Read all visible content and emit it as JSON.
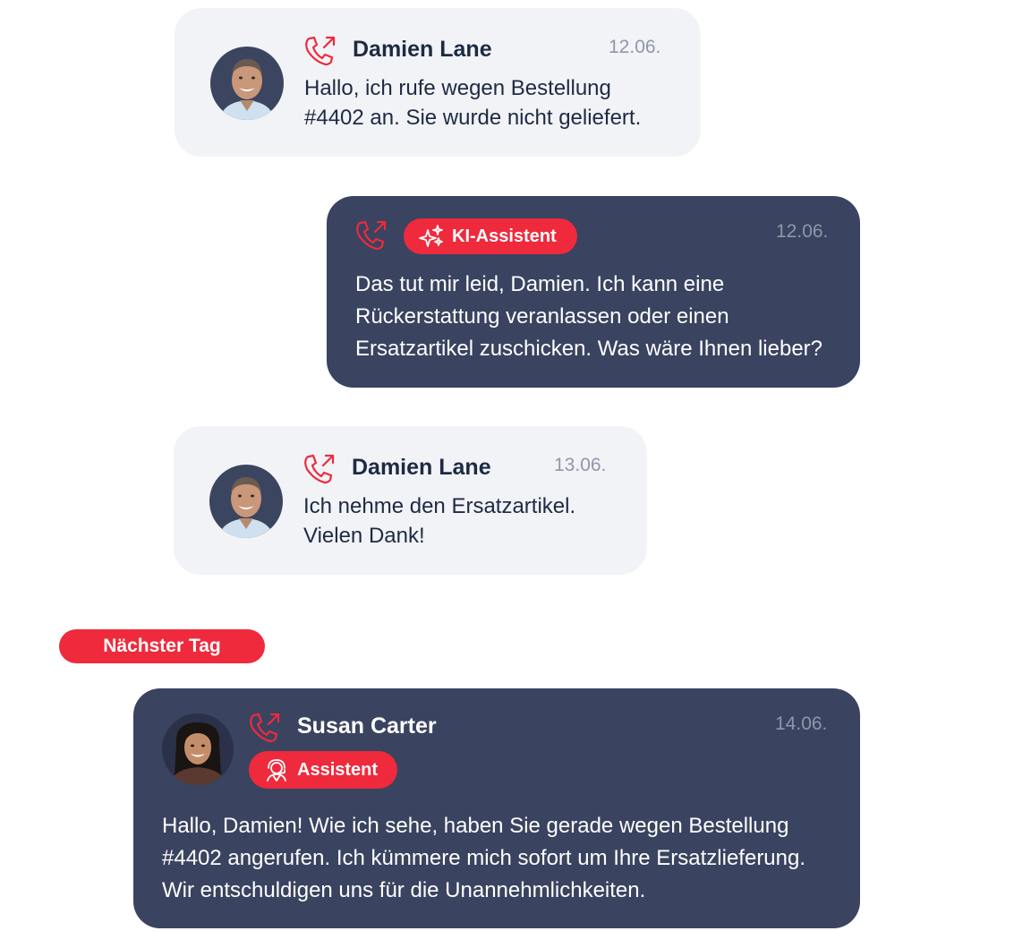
{
  "colors": {
    "accent": "#ee2a3c",
    "dark_bubble": "#3a4360",
    "light_bubble": "#f1f3f6",
    "date_text": "#8f97a9"
  },
  "messages": [
    {
      "sender": "Damien Lane",
      "date": "12.06.",
      "text": "Hallo, ich rufe wegen Bestellung #4402 an. Sie wurde nicht geliefert.",
      "icon": "phone-outgoing-icon"
    },
    {
      "badge": "KI-Assistent",
      "badge_icon": "sparkles-icon",
      "date": "12.06.",
      "text": "Das tut mir leid, Damien. Ich kann eine Rückerstattung veranlassen oder einen Ersatzartikel zuschicken. Was wäre Ihnen lieber?",
      "icon": "phone-outgoing-icon"
    },
    {
      "sender": "Damien Lane",
      "date": "13.06.",
      "text": "Ich nehme den Ersatzartikel. Vielen Dank!",
      "icon": "phone-outgoing-icon"
    },
    {
      "sender": "Susan Carter",
      "badge": "Assistent",
      "badge_icon": "agent-icon",
      "date": "14.06.",
      "text": "Hallo, Damien! Wie ich sehe, haben Sie gerade wegen Bestellung #4402 angerufen. Ich kümmere mich sofort um Ihre Ersatzlieferung. Wir entschuldigen uns für die Unannehmlichkeiten.",
      "icon": "phone-outgoing-icon"
    }
  ],
  "day_separator": "Nächster Tag"
}
